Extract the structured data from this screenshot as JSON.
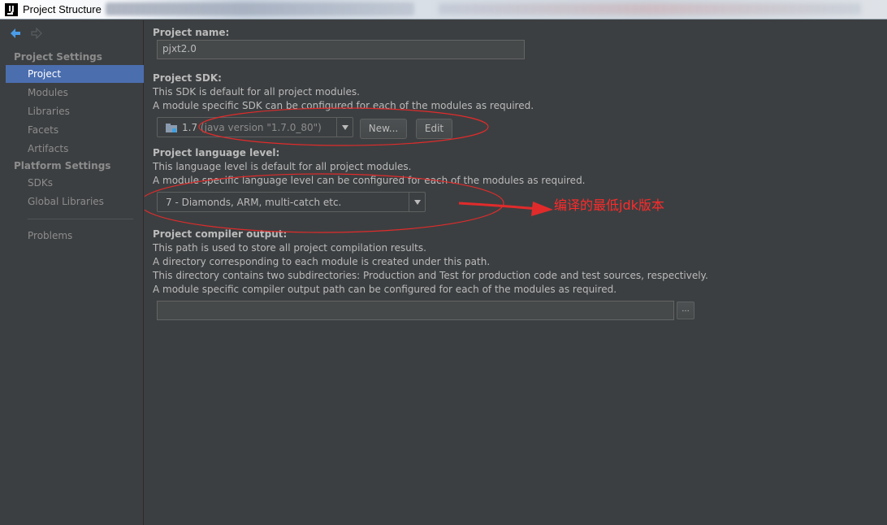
{
  "window": {
    "title": "Project Structure"
  },
  "sidebar": {
    "groups": [
      {
        "header": "Project Settings",
        "items": [
          "Project",
          "Modules",
          "Libraries",
          "Facets",
          "Artifacts"
        ]
      },
      {
        "header": "Platform Settings",
        "items": [
          "SDKs",
          "Global Libraries"
        ]
      }
    ],
    "problems": "Problems",
    "selected": "Project"
  },
  "project": {
    "name_label": "Project name:",
    "name_value": "pjxt2.0",
    "sdk_label": "Project SDK:",
    "sdk_desc1": "This SDK is default for all project modules.",
    "sdk_desc2": "A module specific SDK can be configured for each of the modules as required.",
    "sdk_version": "1.7",
    "sdk_detail": "(java version \"1.7.0_80\")",
    "new_button": "New...",
    "edit_button": "Edit",
    "lang_label": "Project language level:",
    "lang_desc1": "This language level is default for all project modules.",
    "lang_desc2": "A module specific language level can be configured for each of the modules as required.",
    "lang_value": "7 - Diamonds, ARM, multi-catch etc.",
    "output_label": "Project compiler output:",
    "output_desc1": "This path is used to store all project compilation results.",
    "output_desc2": "A directory corresponding to each module is created under this path.",
    "output_desc3": "This directory contains two subdirectories: Production and Test for production code and test sources, respectively.",
    "output_desc4": "A module specific compiler output path can be configured for each of the modules as required.",
    "output_value": "",
    "browse_button": "..."
  },
  "annotation": {
    "text": "编译的最低jdk版本",
    "color": "#ff2a2a"
  },
  "colors": {
    "background": "#3c3f41",
    "selection": "#4b6eaf",
    "annotation": "#ff2a2a"
  }
}
